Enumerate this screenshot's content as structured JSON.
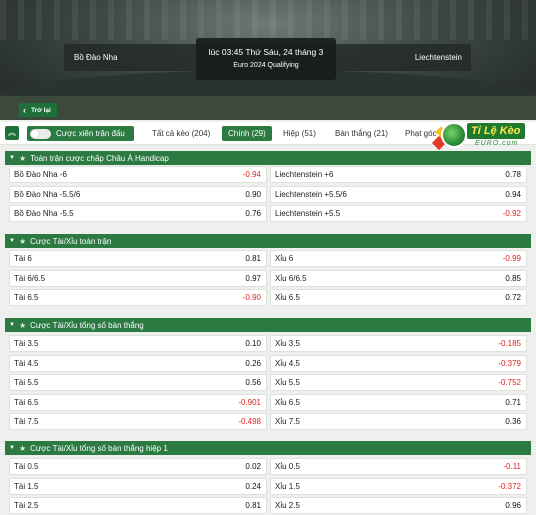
{
  "match": {
    "home": "Bồ Đào Nha",
    "away": "Liechtenstein",
    "time": "lúc 03:45 Thứ Sáu, 24 tháng 3",
    "competition": "Euro 2024 Qualifying",
    "back_label": "Trở lại"
  },
  "filters": {
    "combo_label": "Cược xiên trận đấu",
    "tabs": [
      {
        "label": "Tất cả kèo (204)",
        "active": false
      },
      {
        "label": "Chính (29)",
        "active": true
      },
      {
        "label": "Hiệp (51)",
        "active": false
      },
      {
        "label": "Bàn thắng (21)",
        "active": false
      },
      {
        "label": "Phạt góc",
        "active": false
      }
    ]
  },
  "logo": {
    "title": "Tỉ Lệ Kèo",
    "subtitle": "EURO.com"
  },
  "sections": [
    {
      "title": "Toàn trận cược chấp Châu Á Handicap",
      "rows": [
        {
          "left_label": "Bồ Đào Nha -6",
          "left_odds": "-0.94",
          "left_neg": true,
          "right_label": "Liechtenstein +6",
          "right_odds": "0.78",
          "right_neg": false
        },
        {
          "left_label": "Bồ Đào Nha -5.5/6",
          "left_odds": "0.90",
          "left_neg": false,
          "right_label": "Liechtenstein +5.5/6",
          "right_odds": "0.94",
          "right_neg": false
        },
        {
          "left_label": "Bồ Đào Nha -5.5",
          "left_odds": "0.76",
          "left_neg": false,
          "right_label": "Liechtenstein +5.5",
          "right_odds": "-0.92",
          "right_neg": true
        }
      ]
    },
    {
      "title": "Cược Tài/Xỉu toàn trận",
      "rows": [
        {
          "left_label": "Tài 6",
          "left_odds": "0.81",
          "left_neg": false,
          "right_label": "Xỉu 6",
          "right_odds": "-0.99",
          "right_neg": true
        },
        {
          "left_label": "Tài 6/6.5",
          "left_odds": "0.97",
          "left_neg": false,
          "right_label": "Xỉu 6/6.5",
          "right_odds": "0.85",
          "right_neg": false
        },
        {
          "left_label": "Tài 6.5",
          "left_odds": "-0.90",
          "left_neg": true,
          "right_label": "Xỉu 6.5",
          "right_odds": "0.72",
          "right_neg": false
        }
      ]
    },
    {
      "title": "Cược Tài/Xỉu tổng số bàn thắng",
      "rows": [
        {
          "left_label": "Tài 3.5",
          "left_odds": "0.10",
          "left_neg": false,
          "right_label": "Xỉu 3.5",
          "right_odds": "-0.185",
          "right_neg": true
        },
        {
          "left_label": "Tài 4.5",
          "left_odds": "0.26",
          "left_neg": false,
          "right_label": "Xỉu 4.5",
          "right_odds": "-0.379",
          "right_neg": true
        },
        {
          "left_label": "Tài 5.5",
          "left_odds": "0.56",
          "left_neg": false,
          "right_label": "Xỉu 5.5",
          "right_odds": "-0.752",
          "right_neg": true
        },
        {
          "left_label": "Tài 6.5",
          "left_odds": "-0.901",
          "left_neg": true,
          "right_label": "Xỉu 6.5",
          "right_odds": "0.71",
          "right_neg": false
        },
        {
          "left_label": "Tài 7.5",
          "left_odds": "-0.498",
          "left_neg": true,
          "right_label": "Xỉu 7.5",
          "right_odds": "0.36",
          "right_neg": false
        }
      ]
    },
    {
      "title": "Cược Tài/Xỉu tổng số bàn thắng hiệp 1",
      "rows": [
        {
          "left_label": "Tài 0.5",
          "left_odds": "0.02",
          "left_neg": false,
          "right_label": "Xỉu 0.5",
          "right_odds": "-0.11",
          "right_neg": true
        },
        {
          "left_label": "Tài 1.5",
          "left_odds": "0.24",
          "left_neg": false,
          "right_label": "Xỉu 1.5",
          "right_odds": "-0.372",
          "right_neg": true
        },
        {
          "left_label": "Tài 2.5",
          "left_odds": "0.81",
          "left_neg": false,
          "right_label": "Xỉu 2.5",
          "right_odds": "0.96",
          "right_neg": false
        }
      ]
    }
  ],
  "colors": {
    "accent": "#2b7a42",
    "negative": "#e0231f"
  }
}
